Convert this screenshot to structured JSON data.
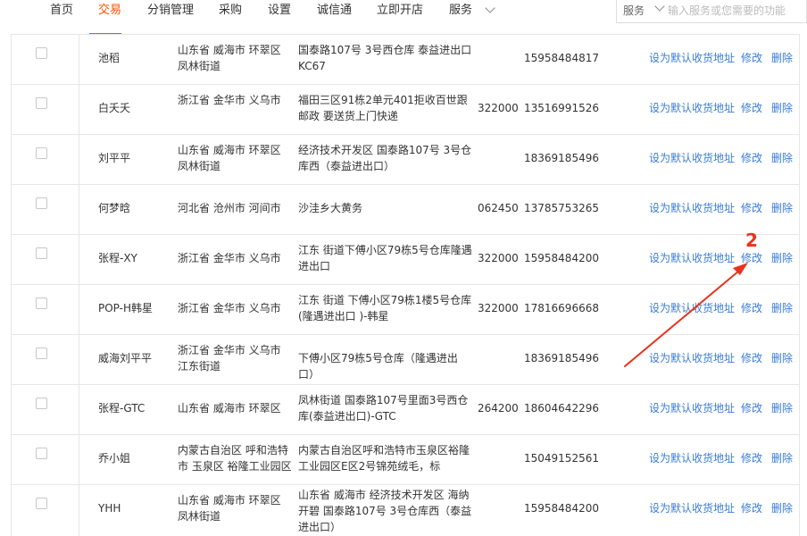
{
  "nav": {
    "items": [
      "首页",
      "交易",
      "分销管理",
      "采购",
      "设置",
      "诚信通",
      "立即开店",
      "服务"
    ],
    "active_index": 1
  },
  "search": {
    "category": "服务",
    "placeholder": "输入服务或您需要的功能"
  },
  "table": {
    "rows": [
      {
        "name": "池稻",
        "region": "山东省 威海市 环翠区 凤林街道",
        "address": "国泰路107号 3号西仓库 泰益进出口KC67",
        "zip": "",
        "phone": "15958484817"
      },
      {
        "name": "白夭夭",
        "region": "浙江省 金华市 义乌市",
        "address": "福田三区91栋2单元401拒收百世跟邮政 要送货上门快递",
        "zip": "322000",
        "phone": "13516991526"
      },
      {
        "name": "刘平平",
        "region": "山东省 威海市 环翠区 凤林街道",
        "address": "经济技术开发区 国泰路107号 3号仓库西（泰益进出口）",
        "zip": "",
        "phone": "18369185496"
      },
      {
        "name": "何梦晗",
        "region": "河北省 沧州市 河间市",
        "address": "沙洼乡大黄务",
        "zip": "062450",
        "phone": "13785753265"
      },
      {
        "name": "张程-XY",
        "region": "浙江省 金华市 义乌市",
        "address": "江东 街道下傅小区79栋5号仓库隆遇进出口",
        "zip": "322000",
        "phone": "15958484200"
      },
      {
        "name": "POP-H韩星",
        "region": "浙江省 金华市 义乌市",
        "address": "江东 街道 下傅小区79栋1楼5号仓库(隆遇进出口 )-韩星",
        "zip": "322000",
        "phone": "17816696668"
      },
      {
        "name": "威海刘平平",
        "region": "浙江省 金华市 义乌市 江东街道",
        "address": "下傅小区79栋5号仓库（隆遇进出口）",
        "zip": "",
        "phone": "18369185496"
      },
      {
        "name": "张程-GTC",
        "region": "山东省 威海市 环翠区",
        "address": "凤林街道 国泰路107号里面3号西仓库(泰益进出口)-GTC",
        "zip": "264200",
        "phone": "18604642296"
      },
      {
        "name": "乔小姐",
        "region": "内蒙古自治区 呼和浩特市 玉泉区 裕隆工业园区",
        "address": "内蒙古自治区呼和浩特市玉泉区裕隆工业园区E区2号锦苑绒毛，标",
        "zip": "",
        "phone": "15049152561"
      },
      {
        "name": "YHH",
        "region": "山东省 威海市 环翠区 凤林街道",
        "address": "山东省 威海市 经济技术开发区 海纳开碧 国泰路107号 3号仓库西（泰益进出口）",
        "zip": "",
        "phone": "15958484200"
      }
    ],
    "actions": {
      "set_default": "设为默认收货地址",
      "edit": "修改",
      "delete": "删除"
    }
  },
  "annotation": {
    "label": "2",
    "color": "#e8331e"
  },
  "colors": {
    "accent": "#ff5000",
    "link": "#3a7cd8",
    "border": "#e6e6e6"
  }
}
